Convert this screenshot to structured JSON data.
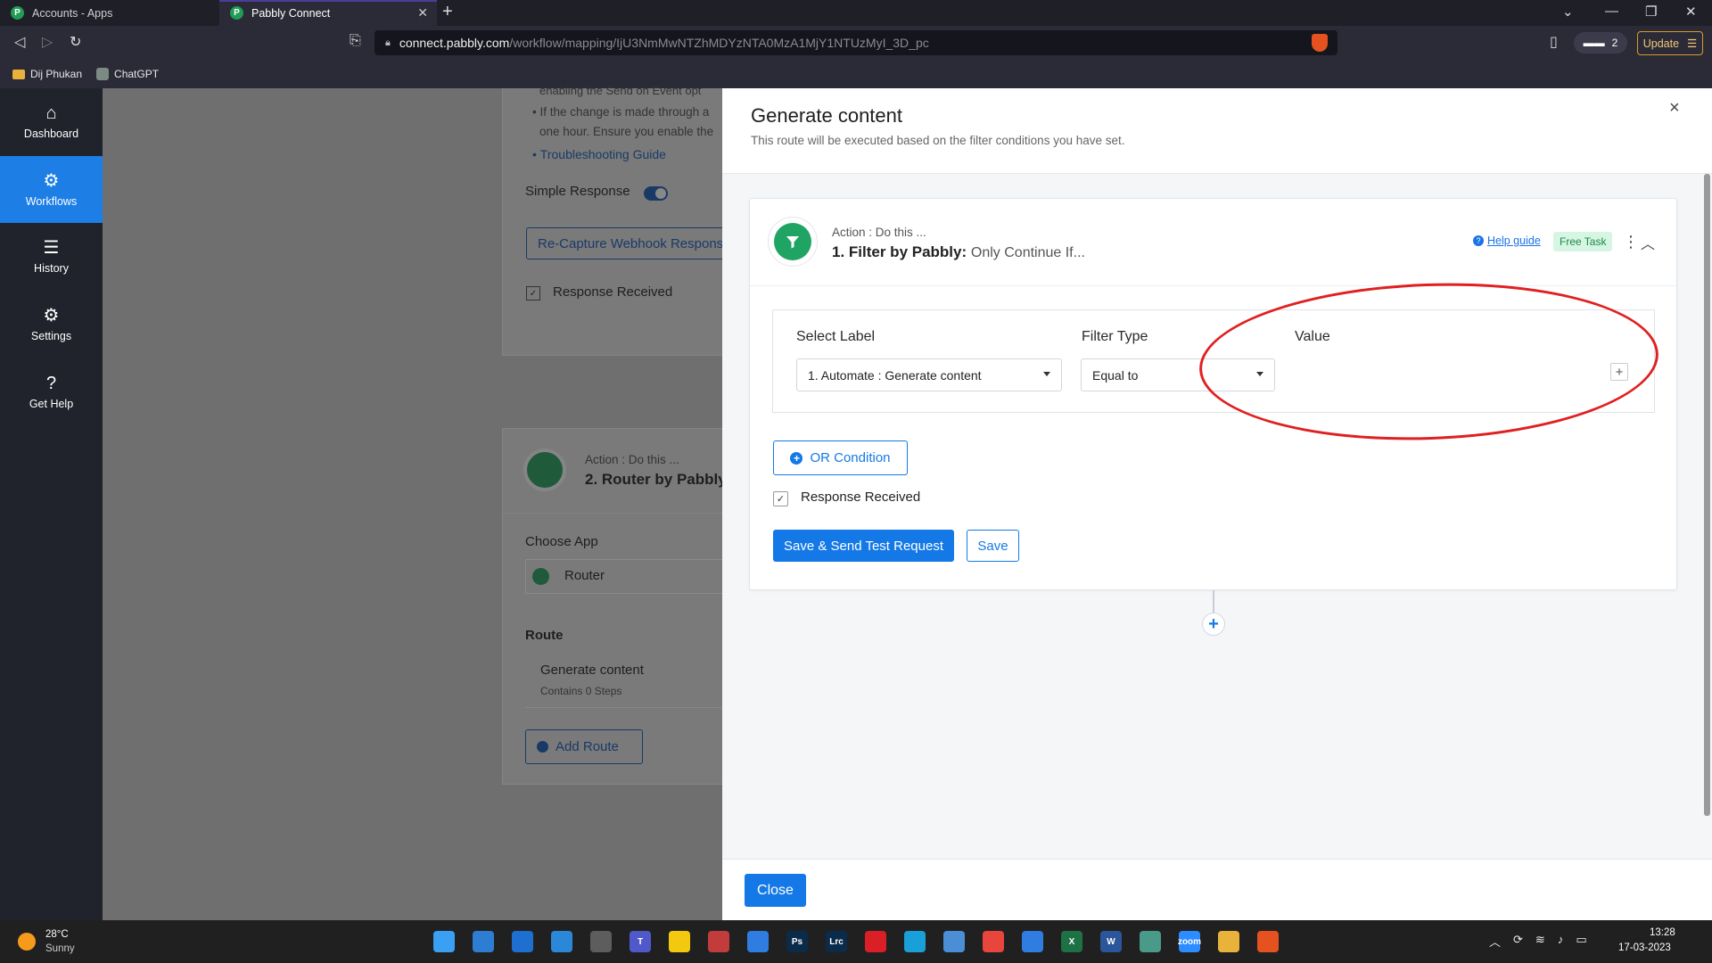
{
  "browser": {
    "tabs": [
      {
        "title": "Accounts - Apps",
        "active": false
      },
      {
        "title": "Pabbly Connect",
        "active": true
      }
    ],
    "url_domain": "connect.pabbly.com",
    "url_path": "/workflow/mapping/IjU3NmMwNTZhMDYzNTA0MzA1MjY1NTUzMyI_3D_pc",
    "wallet_count": "2",
    "update_label": "Update",
    "bookmarks": [
      {
        "label": "Dij Phukan"
      },
      {
        "label": "ChatGPT"
      }
    ]
  },
  "sidebar": {
    "items": [
      {
        "label": "Dashboard",
        "icon": "home-icon",
        "glyph": "⌂",
        "active": false
      },
      {
        "label": "Workflows",
        "icon": "workflows-icon",
        "glyph": "⚙",
        "active": true
      },
      {
        "label": "History",
        "icon": "history-icon",
        "glyph": "☰",
        "active": false
      },
      {
        "label": "Settings",
        "icon": "settings-icon",
        "glyph": "⚙",
        "active": false
      },
      {
        "label": "Get Help",
        "icon": "help-icon",
        "glyph": "?",
        "active": false
      }
    ]
  },
  "background": {
    "line1": "enabling the Send on Event opt",
    "line2": "If the change is made through a",
    "line3": "one hour. Ensure you enable the",
    "troubleshooting": "Troubleshooting Guide",
    "simple_response": "Simple Response",
    "recapture": "Re-Capture Webhook Respons",
    "response_received": "Response Received",
    "action_label": "Action : Do this ...",
    "action_title": "2. Router by Pabbly",
    "choose_app": "Choose App",
    "app_value": "Router",
    "route_heading": "Route",
    "route_name": "Generate content",
    "route_steps": "Contains 0 Steps",
    "add_route": "Add Route"
  },
  "modal": {
    "title": "Generate content",
    "subtitle": "This route will be executed based on the filter conditions you have set.",
    "close_x": "×",
    "action_label": "Action : Do this ...",
    "action_title": "1. Filter by Pabbly:",
    "action_sub": "Only Continue If...",
    "help_guide": "Help guide",
    "free_task": "Free Task",
    "filter": {
      "select_label_heading": "Select Label",
      "select_label_value": "1. Automate : Generate content",
      "filter_type_heading": "Filter Type",
      "filter_type_value": "Equal to",
      "value_heading": "Value",
      "value_add": "+"
    },
    "or_condition": "OR Condition",
    "response_received": "Response Received",
    "save_send": "Save & Send Test Request",
    "save": "Save",
    "close": "Close"
  },
  "taskbar": {
    "weather_temp": "28°C",
    "weather_desc": "Sunny",
    "apps": [
      {
        "name": "windows-start-icon",
        "label": "",
        "color": "#3aa0f3"
      },
      {
        "name": "task-view-icon",
        "label": "",
        "color": "#2d7dd2"
      },
      {
        "name": "widgets-icon",
        "label": "",
        "color": "#1f6fd1"
      },
      {
        "name": "store-icon",
        "label": "",
        "color": "#2b88d8"
      },
      {
        "name": "calculator-icon",
        "label": "",
        "color": "#5d5d5d"
      },
      {
        "name": "teams-icon",
        "label": "T",
        "color": "#5059c9"
      },
      {
        "name": "sticky-notes-icon",
        "label": "",
        "color": "#f2c811"
      },
      {
        "name": "snipping-icon",
        "label": "",
        "color": "#c23c3c"
      },
      {
        "name": "todo-icon",
        "label": "",
        "color": "#2f7de0"
      },
      {
        "name": "photoshop-icon",
        "label": "Ps",
        "color": "#0b2b4a"
      },
      {
        "name": "lightroom-icon",
        "label": "Lrc",
        "color": "#0b2b4a"
      },
      {
        "name": "creative-cloud-icon",
        "label": "",
        "color": "#da1f26"
      },
      {
        "name": "edge-icon",
        "label": "",
        "color": "#1aa0d8"
      },
      {
        "name": "notepad-icon",
        "label": "",
        "color": "#4a8fd6"
      },
      {
        "name": "chrome-icon",
        "label": "",
        "color": "#e8453c"
      },
      {
        "name": "mail-icon",
        "label": "",
        "color": "#2f7de0"
      },
      {
        "name": "excel-icon",
        "label": "X",
        "color": "#1e7145"
      },
      {
        "name": "word-icon",
        "label": "W",
        "color": "#2b579a"
      },
      {
        "name": "maps-icon",
        "label": "",
        "color": "#4a9a8a"
      },
      {
        "name": "zoom-icon",
        "label": "zoom",
        "color": "#2d8cff"
      },
      {
        "name": "file-explorer-icon",
        "label": "",
        "color": "#e9b23a"
      },
      {
        "name": "brave-icon",
        "label": "",
        "color": "#e5521f"
      }
    ],
    "time": "13:28",
    "date": "17-03-2023"
  }
}
